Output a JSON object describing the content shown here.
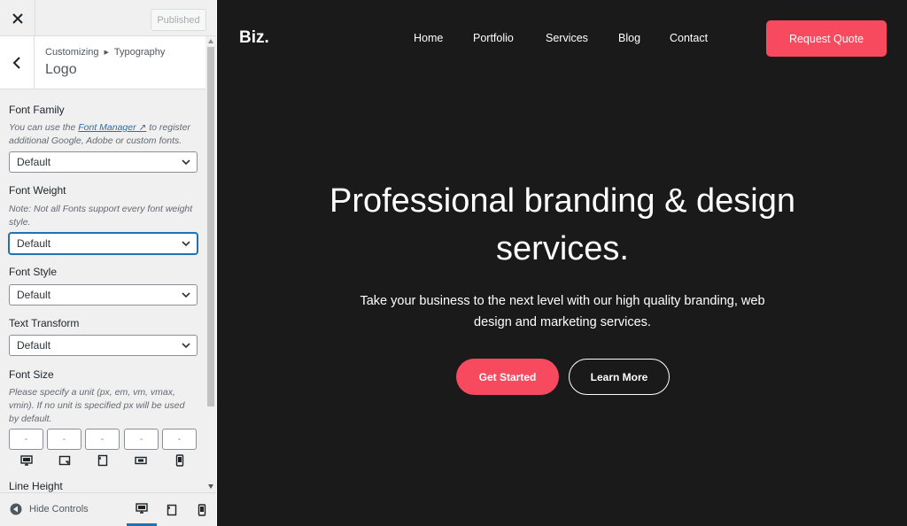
{
  "topbar": {
    "publish_label": "Published"
  },
  "section": {
    "breadcrumb_root": "Customizing",
    "breadcrumb_parent": "Typography",
    "title": "Logo"
  },
  "controls": {
    "font_family": {
      "label": "Font Family",
      "desc_prefix": "You can use the ",
      "desc_link": "Font Manager ↗",
      "desc_suffix": " to register additional Google, Adobe or custom fonts.",
      "value": "Default"
    },
    "font_weight": {
      "label": "Font Weight",
      "desc": "Note: Not all Fonts support every font weight style.",
      "value": "Default"
    },
    "font_style": {
      "label": "Font Style",
      "value": "Default"
    },
    "text_transform": {
      "label": "Text Transform",
      "value": "Default"
    },
    "font_size": {
      "label": "Font Size",
      "desc": "Please specify a unit (px, em, vm, vmax, vmin). If no unit is specified px will be used by default.",
      "placeholders": [
        "-",
        "-",
        "-",
        "-",
        "-"
      ]
    },
    "line_height": {
      "label": "Line Height"
    }
  },
  "footer": {
    "hide_controls_label": "Hide Controls"
  },
  "site": {
    "logo": "Biz.",
    "nav": [
      "Home",
      "Portfolio",
      "Services",
      "Blog",
      "Contact"
    ],
    "cta_label": "Request Quote",
    "hero_title": "Professional branding & design services.",
    "hero_subtitle": "Take your business to the next level with our high quality branding, web design and marketing services.",
    "primary_button": "Get Started",
    "secondary_button": "Learn More"
  },
  "colors": {
    "accent": "#f84a5f",
    "preview_bg": "#1b1a1b",
    "wp_blue": "#2271b1"
  },
  "icons": {
    "close": "close-icon",
    "back": "chevron-left-icon",
    "select": "chevron-down-icon",
    "hide": "collapse-icon",
    "desktop": "desktop-icon",
    "tablet": "tablet-icon",
    "mobile": "mobile-icon"
  }
}
